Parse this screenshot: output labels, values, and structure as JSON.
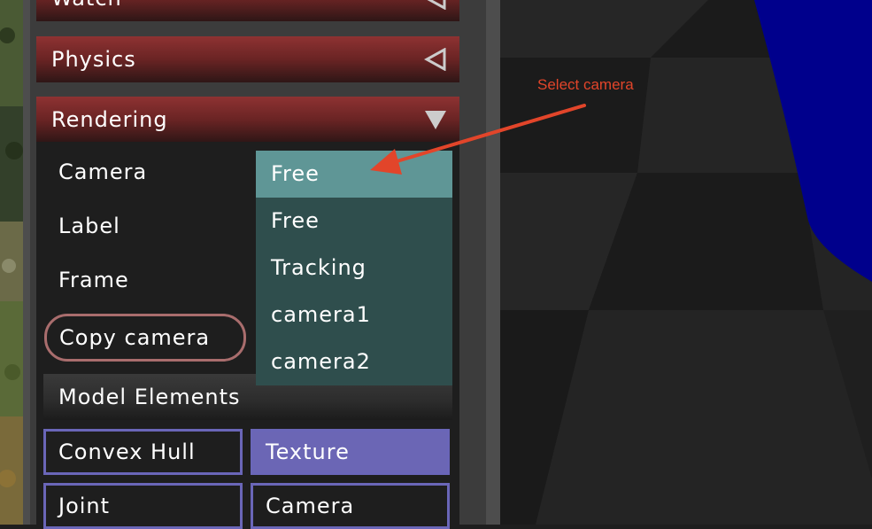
{
  "sections": {
    "watch": {
      "title": "Watch"
    },
    "physics": {
      "title": "Physics"
    },
    "rendering": {
      "title": "Rendering",
      "rows": {
        "camera": "Camera",
        "label": "Label",
        "frame": "Frame"
      },
      "copy_camera": "Copy camera",
      "model_elements": {
        "title": "Model Elements",
        "toggles": [
          {
            "label": "Convex Hull",
            "active": false
          },
          {
            "label": "Texture",
            "active": true
          },
          {
            "label": "Joint",
            "active": false
          },
          {
            "label": "Camera",
            "active": false
          }
        ]
      }
    }
  },
  "camera_dropdown": {
    "selected": "Free",
    "options": [
      "Free",
      "Tracking",
      "camera1",
      "camera2"
    ]
  },
  "annotation": {
    "text": "Select camera",
    "color": "#e2452a"
  },
  "colors": {
    "header_red": "#8e3232",
    "dropdown_bg": "#2f4e4d",
    "dropdown_selected": "#5f9696",
    "toggle_border": "#6a66b8",
    "toggle_active": "#6b66b5",
    "copy_border": "#a96d6d",
    "scene_blue": "#00008c"
  }
}
